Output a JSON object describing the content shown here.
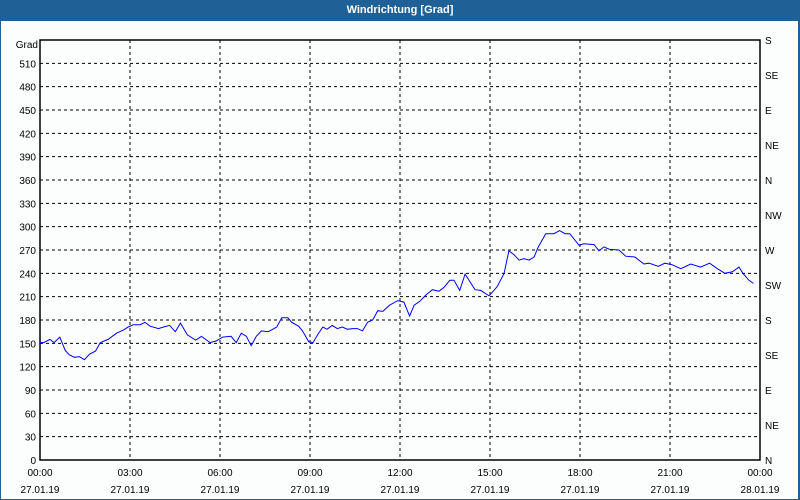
{
  "window": {
    "title": "Windrichtung [Grad]"
  },
  "chart_data": {
    "type": "line",
    "title": "Windrichtung [Grad]",
    "ylabel": "Grad",
    "ylim": [
      0,
      540
    ],
    "yticks": [
      0,
      30,
      60,
      90,
      120,
      150,
      180,
      210,
      240,
      270,
      300,
      330,
      360,
      390,
      420,
      450,
      480,
      510
    ],
    "right_ticks": [
      {
        "value": 0,
        "label": "N"
      },
      {
        "value": 45,
        "label": "NE"
      },
      {
        "value": 90,
        "label": "E"
      },
      {
        "value": 135,
        "label": "SE"
      },
      {
        "value": 180,
        "label": "S"
      },
      {
        "value": 225,
        "label": "SW"
      },
      {
        "value": 270,
        "label": "W"
      },
      {
        "value": 315,
        "label": "NW"
      },
      {
        "value": 360,
        "label": "N"
      },
      {
        "value": 405,
        "label": "NE"
      },
      {
        "value": 450,
        "label": "E"
      },
      {
        "value": 495,
        "label": "SE"
      },
      {
        "value": 540,
        "label": "S"
      }
    ],
    "xlim_hours": [
      0,
      24
    ],
    "xticks": [
      {
        "hour": 0,
        "time": "00:00",
        "date": "27.01.19"
      },
      {
        "hour": 3,
        "time": "03:00",
        "date": "27.01.19"
      },
      {
        "hour": 6,
        "time": "06:00",
        "date": "27.01.19"
      },
      {
        "hour": 9,
        "time": "09:00",
        "date": "27.01.19"
      },
      {
        "hour": 12,
        "time": "12:00",
        "date": "27.01.19"
      },
      {
        "hour": 15,
        "time": "15:00",
        "date": "27.01.19"
      },
      {
        "hour": 18,
        "time": "18:00",
        "date": "27.01.19"
      },
      {
        "hour": 21,
        "time": "21:00",
        "date": "27.01.19"
      },
      {
        "hour": 24,
        "time": "00:00",
        "date": "28.01.19"
      }
    ],
    "grid": true,
    "series": [
      {
        "name": "Windrichtung",
        "color": "#0000ff",
        "x": [
          0,
          0.13,
          0.33,
          0.47,
          0.66,
          0.84,
          0.98,
          1.15,
          1.31,
          1.48,
          1.65,
          1.85,
          2.01,
          2.27,
          2.55,
          2.78,
          2.94,
          3.11,
          3.34,
          3.5,
          3.67,
          3.95,
          4.12,
          4.32,
          4.51,
          4.68,
          4.91,
          5.19,
          5.38,
          5.67,
          5.87,
          6.09,
          6.37,
          6.54,
          6.71,
          6.88,
          7.04,
          7.21,
          7.38,
          7.61,
          7.89,
          8.06,
          8.26,
          8.39,
          8.62,
          8.75,
          8.96,
          9.1,
          9.27,
          9.43,
          9.57,
          9.74,
          9.91,
          10.08,
          10.25,
          10.42,
          10.58,
          10.75,
          10.92,
          11.09,
          11.26,
          11.43,
          11.65,
          11.93,
          12.13,
          12.32,
          12.47,
          12.66,
          12.86,
          13.08,
          13.3,
          13.47,
          13.66,
          13.8,
          13.99,
          14.17,
          14.5,
          14.69,
          14.97,
          15.24,
          15.47,
          15.63,
          15.8,
          15.97,
          16.13,
          16.3,
          16.47,
          16.61,
          16.86,
          17.13,
          17.32,
          17.5,
          17.66,
          17.97,
          18.13,
          18.47,
          18.63,
          18.8,
          18.97,
          19.3,
          19.52,
          19.83,
          20.13,
          20.3,
          20.61,
          20.83,
          21.08,
          21.36,
          21.69,
          22.02,
          22.32,
          22.58,
          22.83,
          23.08,
          23.3,
          23.43,
          23.63,
          23.78
        ],
        "y": [
          151,
          151,
          155,
          151,
          158,
          141,
          135,
          132,
          133,
          129,
          136,
          140,
          151,
          155,
          163,
          167,
          171,
          174,
          174,
          177,
          172,
          169,
          171,
          173,
          165,
          176,
          161,
          154,
          159,
          151,
          153,
          158,
          159,
          151,
          163,
          159,
          147,
          159,
          166,
          165,
          171,
          183,
          183,
          177,
          172,
          166,
          152,
          151,
          162,
          171,
          168,
          173,
          169,
          171,
          168,
          169,
          169,
          166,
          177,
          180,
          192,
          191,
          199,
          205,
          203,
          185,
          199,
          204,
          212,
          219,
          217,
          222,
          231,
          231,
          218,
          239,
          219,
          218,
          211,
          223,
          240,
          269,
          264,
          257,
          259,
          257,
          261,
          274,
          291,
          291,
          295,
          291,
          291,
          276,
          278,
          277,
          269,
          274,
          271,
          270,
          262,
          261,
          252,
          253,
          249,
          253,
          251,
          246,
          252,
          248,
          253,
          246,
          240,
          242,
          248,
          240,
          231,
          227
        ]
      }
    ]
  }
}
